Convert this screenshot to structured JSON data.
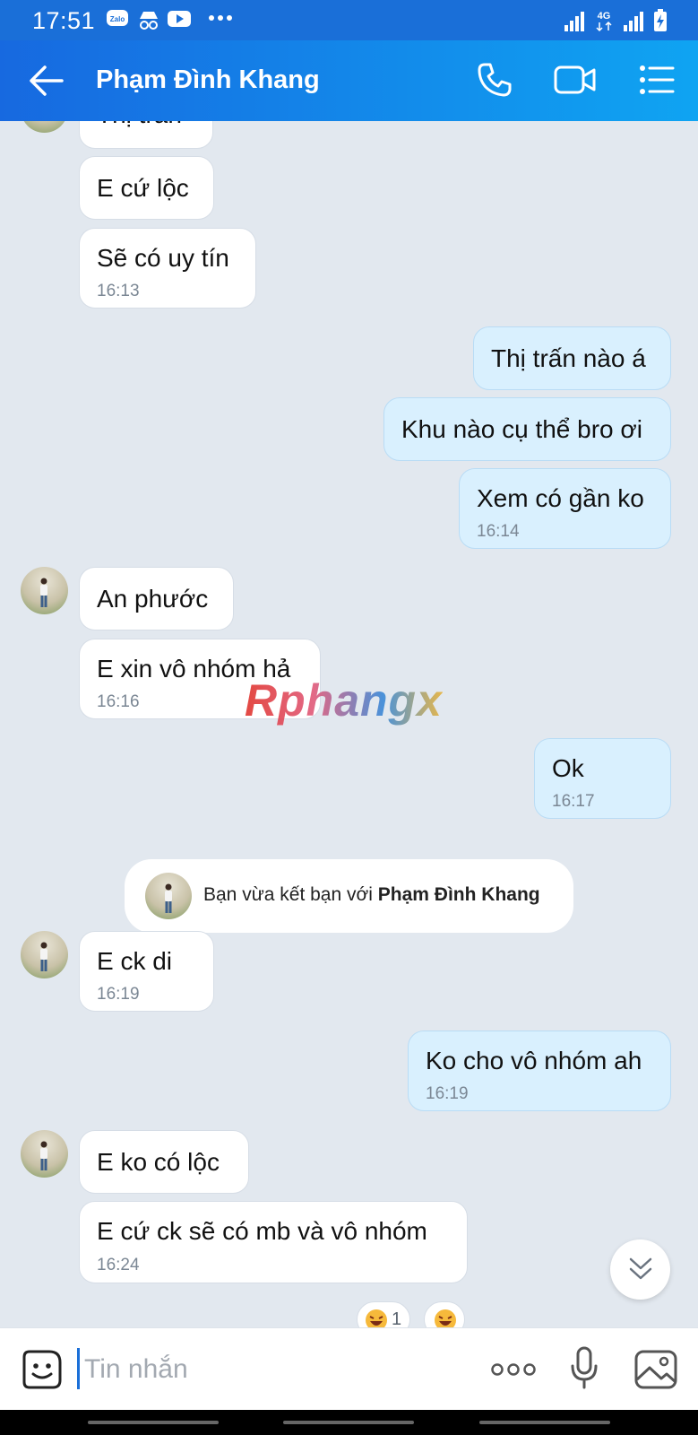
{
  "status_bar": {
    "time": "17:51",
    "network": "4G",
    "app_badge": "Zalo"
  },
  "header": {
    "title": "Phạm Đình Khang"
  },
  "chat": {
    "partial_top": "Thị trấn",
    "messages": [
      {
        "text": "E cứ lộc"
      },
      {
        "text": "Sẽ có uy tín",
        "time": "16:13"
      },
      {
        "text": "Thị trấn nào á"
      },
      {
        "text": "Khu nào cụ thể bro ơi"
      },
      {
        "text": "Xem có gần ko",
        "time": "16:14"
      },
      {
        "text": "An phước"
      },
      {
        "text": "E xin vô nhóm hả",
        "time": "16:16"
      },
      {
        "text": "Ok",
        "time": "16:17"
      },
      {
        "text": "E ck di",
        "time": "16:19"
      },
      {
        "text": "Ko cho vô nhóm ah",
        "time": "16:19"
      },
      {
        "text": "E ko có lộc"
      },
      {
        "text": "E cứ ck sẽ có mb và vô nhóm",
        "time": "16:24"
      }
    ],
    "system_message": {
      "prefix": "Bạn vừa kết bạn với",
      "name": "Phạm Đình Khang"
    },
    "reaction_count": "1",
    "watermark": "Rphangx"
  },
  "input": {
    "placeholder": "Tin nhắn"
  },
  "icons": {
    "back": "arrow-left-icon",
    "call": "phone-icon",
    "video": "video-camera-icon",
    "menu": "list-menu-icon",
    "sticker": "sticker-face-icon",
    "more": "more-dots-icon",
    "mic": "microphone-icon",
    "gallery": "image-icon",
    "scroll": "double-chevron-down-icon"
  },
  "colors": {
    "header_start": "#1769e0",
    "header_end": "#0fa4f2",
    "outgoing_bubble": "#d9f0fe",
    "incoming_bubble": "#ffffff",
    "chat_bg": "#e2e8ef"
  }
}
